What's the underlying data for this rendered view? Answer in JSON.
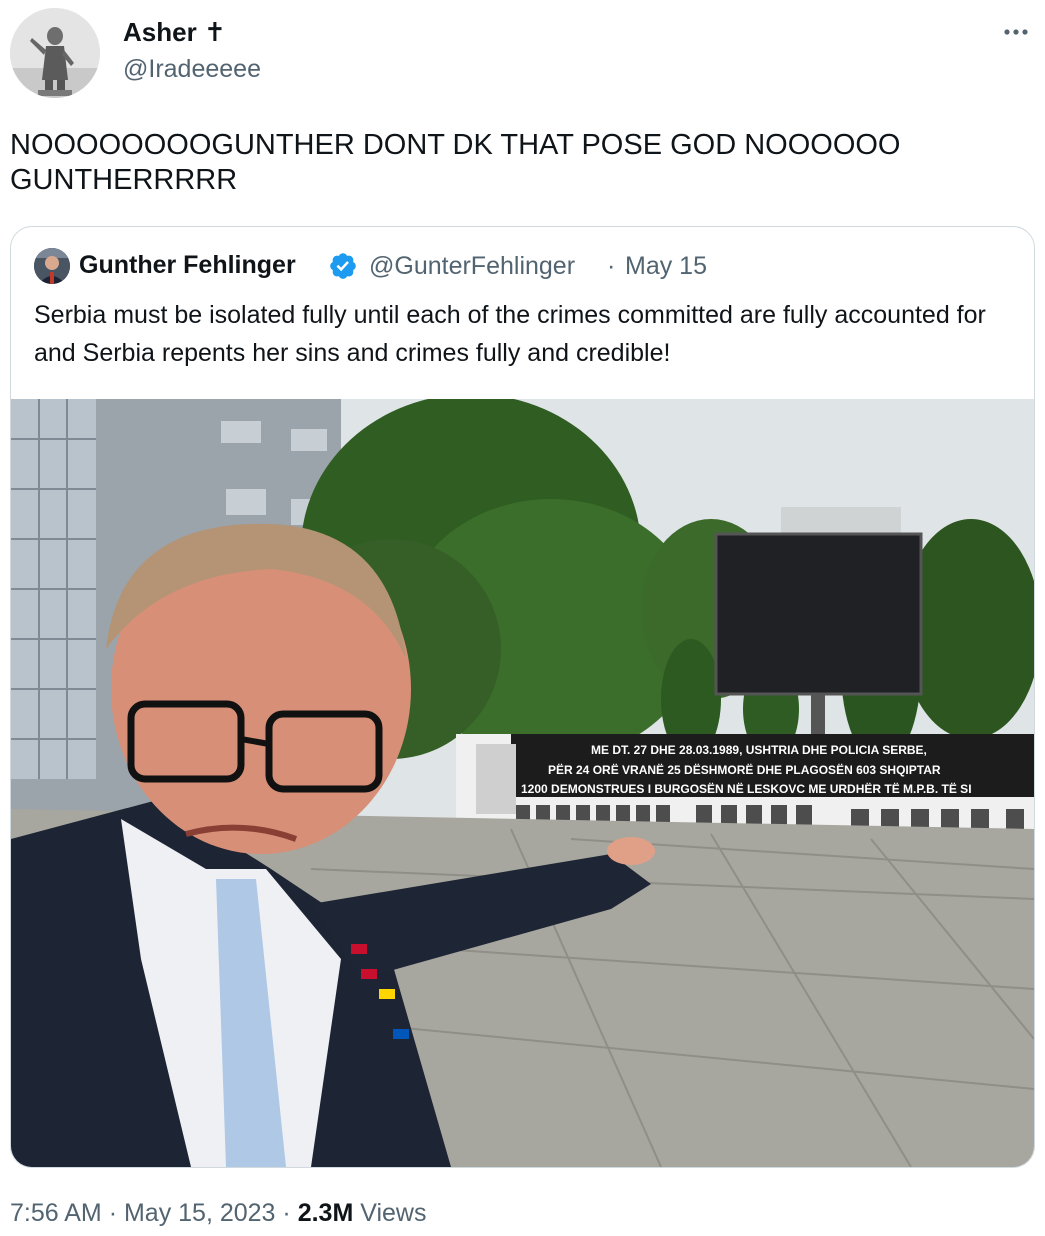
{
  "author": {
    "name": "Asher",
    "name_symbol": "✝",
    "handle": "@Iradeeeee"
  },
  "icons": {
    "more": "more-dots-icon",
    "verified": "verified-badge-icon",
    "verified_color": "#1d9bf0"
  },
  "tweet": {
    "text": "NOOOOOOOOGUNTHER DONT DK THAT POSE GOD NOOOOOO GUNTHERRRRR"
  },
  "quoted": {
    "name": "Gunther Fehlinger",
    "handle": "@GunterFehlinger",
    "separator": "·",
    "date": "May 15",
    "text": "Serbia must be isolated fully until each of the crimes committed are fully accounted for and Serbia repents her sins and crimes fully and credible!",
    "image": {
      "banner_lines": [
        "ME DT. 27 DHE 28.03.1989, USHTRIA DHE POLICIA SERBE,",
        "PËR 24 ORË VRANË 25 DËSHMORË DHE PLAGOSËN 603 SHQIPTAR",
        "1200 DEMONSTRUES I BURGOSËN NË LESKOVC ME URDHËR TË M.P.B. TË SI"
      ]
    }
  },
  "meta": {
    "time": "7:56 AM",
    "separator": "·",
    "date": "May 15, 2023",
    "views_count": "2.3M",
    "views_label": "Views"
  }
}
